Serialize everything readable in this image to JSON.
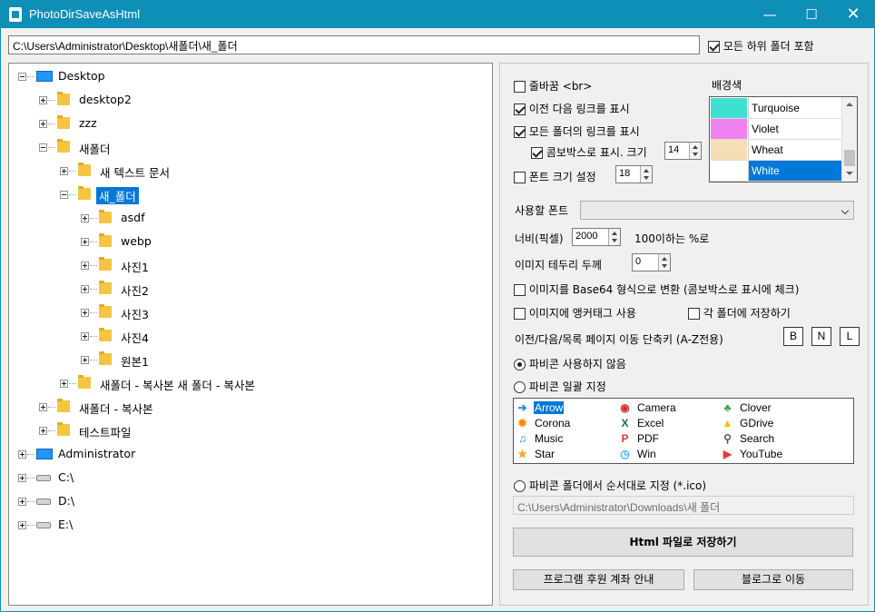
{
  "window": {
    "title": "PhotoDirSaveAsHtml"
  },
  "path_input": {
    "value": "C:\\Users\\Administrator\\Desktop\\새폴더\\새_폴더"
  },
  "include_subfolders": {
    "label": "모든 하위 폴더 포함",
    "checked": true
  },
  "tree": [
    {
      "label": "Desktop",
      "type": "monitor",
      "expanded": true
    },
    {
      "label": "desktop2",
      "type": "folder"
    },
    {
      "label": "zzz",
      "type": "folder"
    },
    {
      "label": "새폴더",
      "type": "folder",
      "expanded": true
    },
    {
      "label": "새 텍스트 문서",
      "type": "folder"
    },
    {
      "label": "새_폴더",
      "type": "folder",
      "expanded": true,
      "selected": true
    },
    {
      "label": "asdf",
      "type": "folder"
    },
    {
      "label": "webp",
      "type": "folder"
    },
    {
      "label": "사진1",
      "type": "folder"
    },
    {
      "label": "사진2",
      "type": "folder"
    },
    {
      "label": "사진3",
      "type": "folder"
    },
    {
      "label": "사진4",
      "type": "folder"
    },
    {
      "label": "원본1",
      "type": "folder"
    },
    {
      "label": "새폴더 - 복사본 새 폴더 - 복사본",
      "type": "folder"
    },
    {
      "label": "새폴더 - 복사본",
      "type": "folder"
    },
    {
      "label": "테스트파일",
      "type": "folder"
    },
    {
      "label": "Administrator",
      "type": "monitor"
    },
    {
      "label": "C:\\",
      "type": "drive"
    },
    {
      "label": "D:\\",
      "type": "drive"
    },
    {
      "label": "E:\\",
      "type": "drive"
    }
  ],
  "options": {
    "line_break": {
      "label": "줄바꿈 <br>",
      "checked": false
    },
    "prev_next_links": {
      "label": "이전 다음 링크를 표시",
      "checked": true
    },
    "all_folder_links": {
      "label": "모든 폴더의 링크를 표시",
      "checked": true
    },
    "combo_display": {
      "label": "콤보박스로 표시. 크기",
      "checked": true,
      "size": "14"
    },
    "font_size": {
      "label": "폰트 크기 설정",
      "checked": false,
      "size": "18"
    }
  },
  "bgcolor": {
    "label": "배경색",
    "items": [
      {
        "name": "Turquoise",
        "color": "#40e0d0"
      },
      {
        "name": "Violet",
        "color": "#ee82ee"
      },
      {
        "name": "Wheat",
        "color": "#f5deb3"
      },
      {
        "name": "White",
        "color": "#ffffff",
        "selected": true
      }
    ]
  },
  "font_select": {
    "label": "사용할 폰트",
    "value": ""
  },
  "width": {
    "label": "너비(픽셀)",
    "value": "2000",
    "hint": "100이하는 %로"
  },
  "border": {
    "label": "이미지 테두리 두께",
    "value": "0"
  },
  "base64": {
    "label": "이미지를 Base64 형식으로 변환 (콤보박스로 표시에 체크)",
    "checked": false
  },
  "anchor": {
    "label": "이미지에 앵커태그 사용",
    "checked": false
  },
  "save_each": {
    "label": "각 폴더에 저장하기",
    "checked": false
  },
  "shortcut": {
    "label": "이전/다음/목록 페이지 이동 단축키 (A-Z전용)",
    "keys": [
      "B",
      "N",
      "L"
    ]
  },
  "favicon": {
    "none": {
      "label": "파비콘 사용하지 않음",
      "selected": true
    },
    "batch": {
      "label": "파비콘 일괄 지정",
      "selected": false
    },
    "sequential": {
      "label": "파비콘 폴더에서 순서대로 지정 (*.ico)",
      "selected": false
    },
    "folder_path": "C:\\Users\\Administrator\\Downloads\\새 폴더",
    "icons": [
      {
        "name": "Arrow",
        "icon": "arrow-icon",
        "color": "#1e88e5",
        "selected": true
      },
      {
        "name": "Camera",
        "icon": "camera-icon",
        "color": "#d32f2f"
      },
      {
        "name": "Clover",
        "icon": "clover-icon",
        "color": "#43a047"
      },
      {
        "name": "Corona",
        "icon": "corona-icon",
        "color": "#fb8c00"
      },
      {
        "name": "Excel",
        "icon": "excel-icon",
        "color": "#1e7145"
      },
      {
        "name": "GDrive",
        "icon": "gdrive-icon",
        "color": "#fbbc04"
      },
      {
        "name": "Music",
        "icon": "music-icon",
        "color": "#1e88e5"
      },
      {
        "name": "PDF",
        "icon": "pdf-icon",
        "color": "#e53935"
      },
      {
        "name": "Search",
        "icon": "search-icon",
        "color": "#555555"
      },
      {
        "name": "Star",
        "icon": "star-icon",
        "color": "#f9a825"
      },
      {
        "name": "Win",
        "icon": "windows-icon",
        "color": "#29b6f6"
      },
      {
        "name": "YouTube",
        "icon": "youtube-icon",
        "color": "#e53935"
      }
    ]
  },
  "buttons": {
    "save_html": "Html 파일로 저장하기",
    "donate": "프로그램 후원 계좌 안내",
    "blog": "블로그로 이동"
  }
}
